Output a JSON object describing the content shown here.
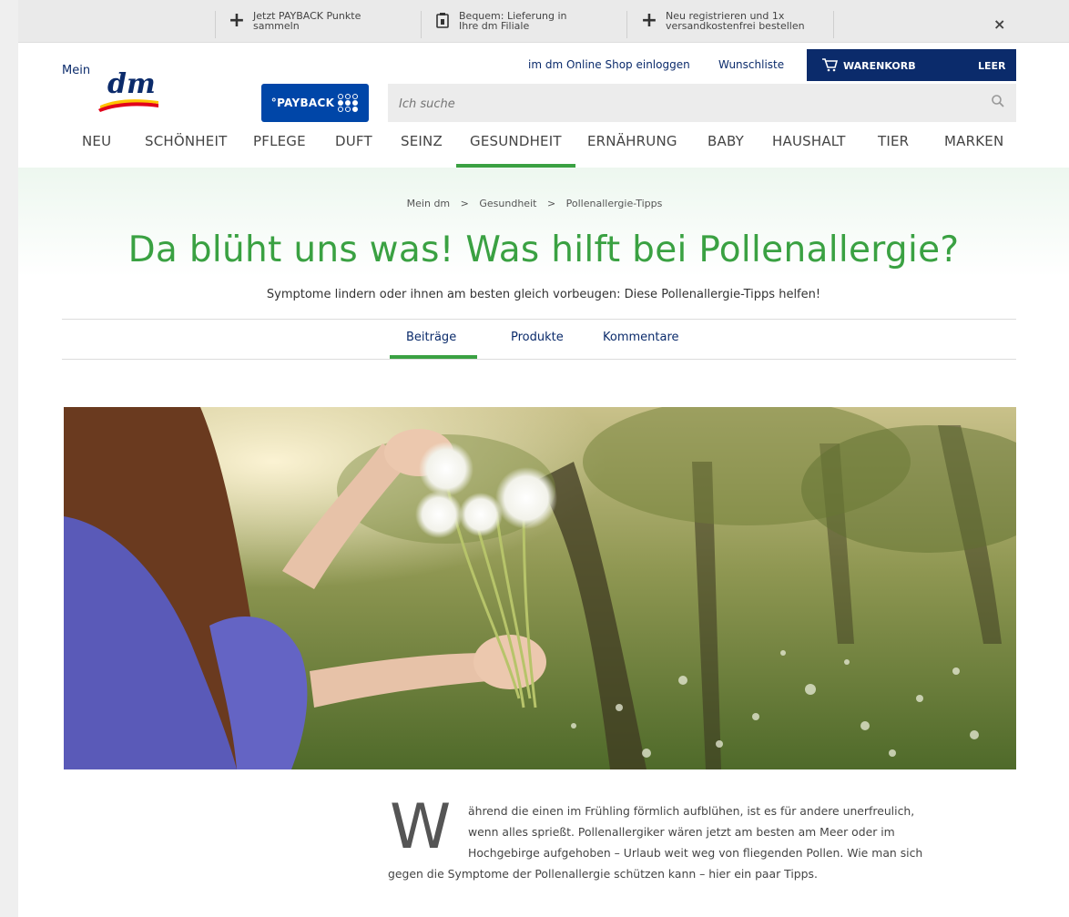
{
  "promo_bar": {
    "items": [
      {
        "icon": "plus-icon",
        "line1": "Jetzt PAYBACK Punkte",
        "line2": "sammeln"
      },
      {
        "icon": "package-icon",
        "line1": "Bequem: Lieferung in",
        "line2": "Ihre dm Filiale"
      },
      {
        "icon": "plus-icon",
        "line1": "Neu registrieren und 1x",
        "line2": "versandkostenfrei bestellen"
      }
    ],
    "close_label": "×"
  },
  "logo": {
    "mein": "Mein",
    "dm": "dm"
  },
  "payback": {
    "label": "°PAYBACK"
  },
  "header": {
    "login_link": "im dm Online Shop einloggen",
    "wishlist_link": "Wunschliste",
    "cart_label": "WARENKORB",
    "cart_state": "LEER"
  },
  "search": {
    "placeholder": "Ich suche"
  },
  "nav": {
    "items": [
      "NEU",
      "SCHÖNHEIT",
      "PFLEGE",
      "DUFT",
      "SEINZ",
      "GESUNDHEIT",
      "ERNÄHRUNG",
      "BABY",
      "HAUSHALT",
      "TIER",
      "MARKEN"
    ],
    "active": "GESUNDHEIT"
  },
  "breadcrumb": {
    "items": [
      "Mein dm",
      "Gesundheit",
      "Pollenallergie-Tipps"
    ],
    "separator": ">"
  },
  "page": {
    "title": "Da blüht uns was! Was hilft bei Pollenallergie?",
    "subtitle": "Symptome lindern oder ihnen am besten gleich vorbeugen: Diese Pollenallergie-Tipps helfen!"
  },
  "tabs": {
    "items": [
      "Beiträge",
      "Produkte",
      "Kommentare"
    ],
    "active": "Beiträge"
  },
  "article": {
    "dropcap": "W",
    "lines": [
      "ährend die einen im Frühling förmlich aufblühen, ist es für andere unerfreulich,",
      "wenn alles sprießt. Pollenallergiker wären jetzt am besten am Meer oder im",
      "Hochgebirge aufgehoben – Urlaub weit weg von fliegenden Pollen. Wie man sich",
      "gegen die Symptome der Pollenallergie schützen kann – hier ein paar Tipps."
    ]
  },
  "colors": {
    "brand_green": "#3aa142",
    "brand_blue": "#0b2b6b",
    "payback_blue": "#0046a8"
  }
}
